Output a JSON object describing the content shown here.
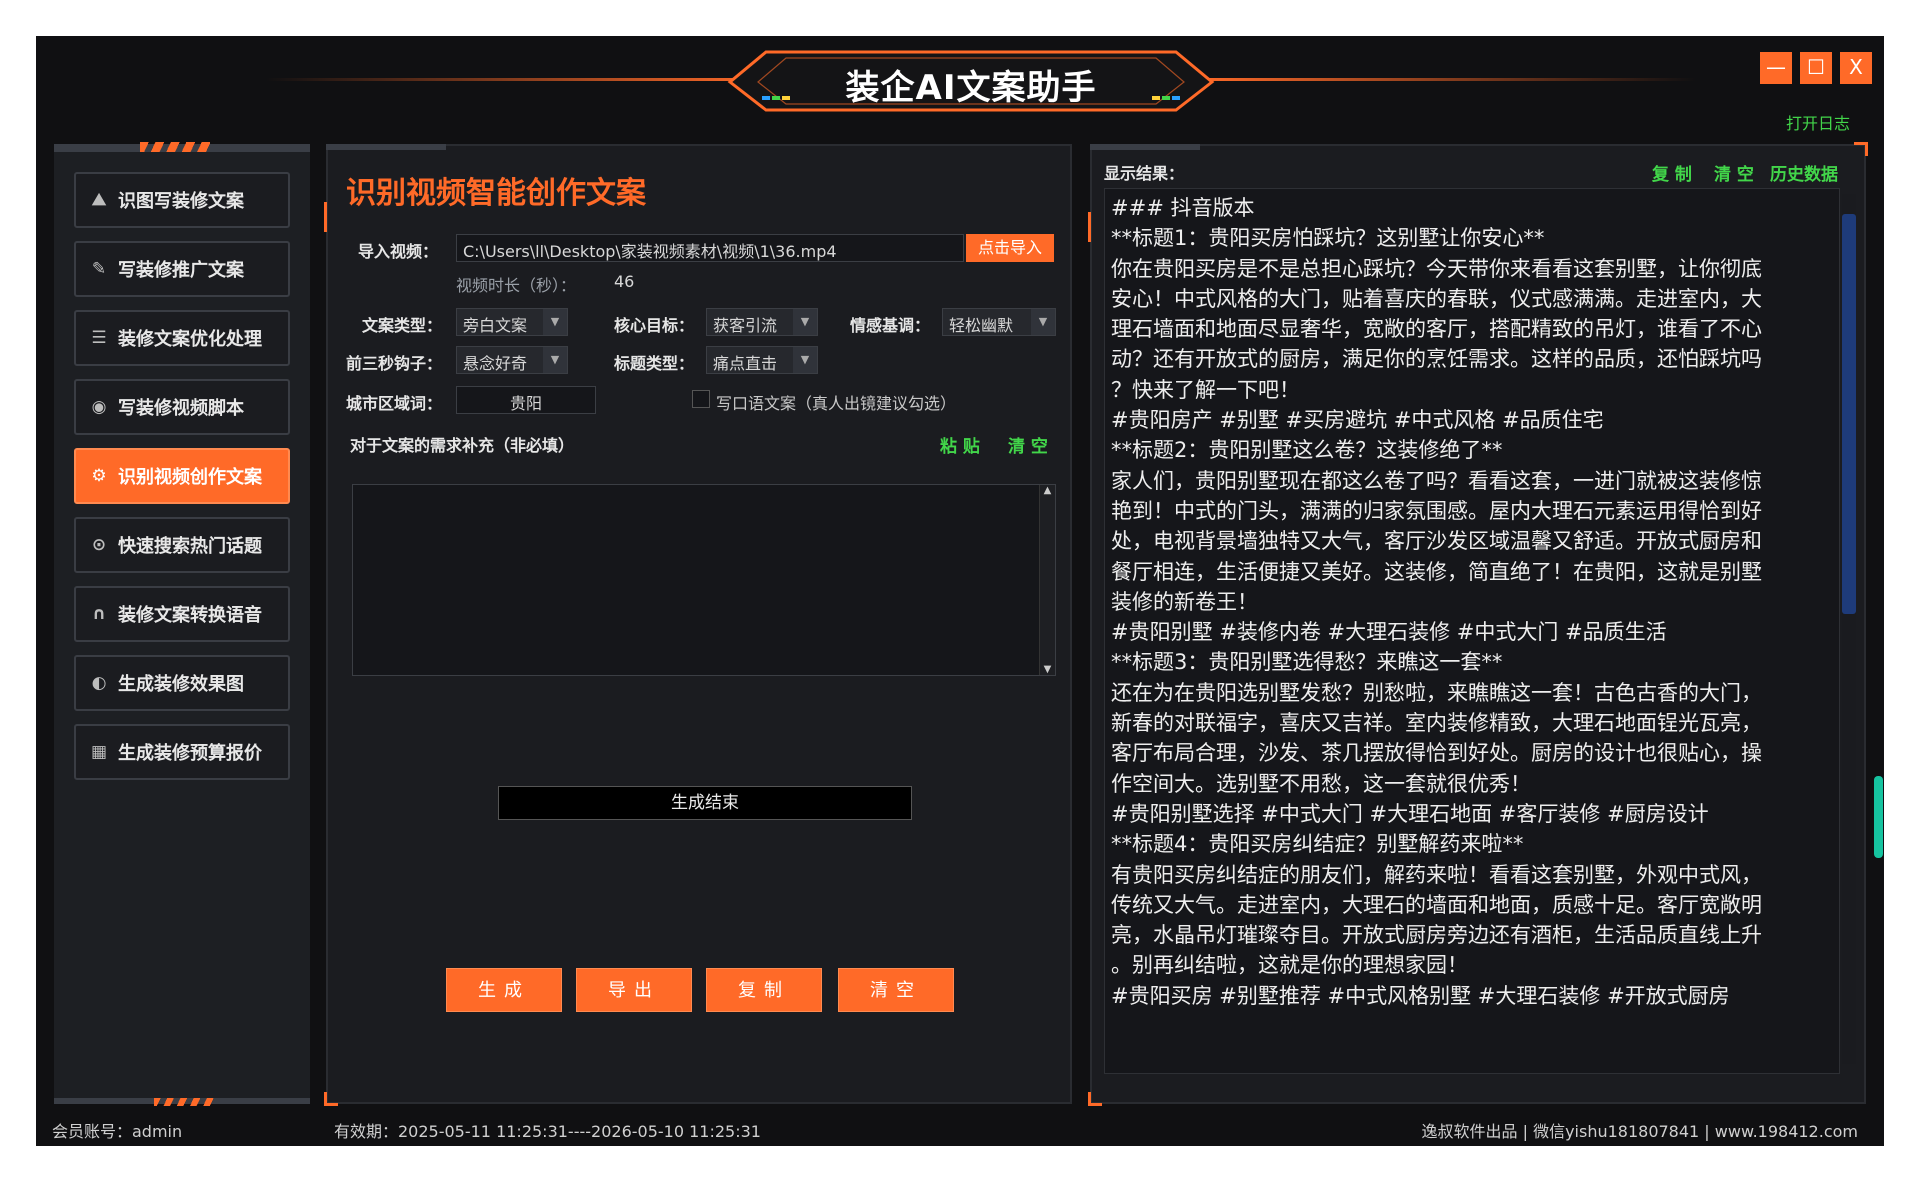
{
  "app": {
    "title": "装企AI文案助手",
    "open_log": "打开日志",
    "win_min": "—",
    "win_max": "☐",
    "win_close": "X"
  },
  "sidebar": {
    "items": [
      {
        "label": "识图写装修文案",
        "icon": "picture-icon",
        "glyph": "⛰"
      },
      {
        "label": "写装修推广文案",
        "icon": "pen-icon",
        "glyph": "✎"
      },
      {
        "label": "装修文案优化处理",
        "icon": "document-icon",
        "glyph": "☰"
      },
      {
        "label": "写装修视频脚本",
        "icon": "camera-icon",
        "glyph": "◉"
      },
      {
        "label": "识别视频创作文案",
        "icon": "video-icon",
        "glyph": "⚙"
      },
      {
        "label": "快速搜索热门话题",
        "icon": "location-icon",
        "glyph": "⊙"
      },
      {
        "label": "装修文案转换语音",
        "icon": "headphones-icon",
        "glyph": "∩"
      },
      {
        "label": "生成装修效果图",
        "icon": "palette-icon",
        "glyph": "◐"
      },
      {
        "label": "生成装修预算报价",
        "icon": "calculator-icon",
        "glyph": "▦"
      }
    ],
    "active_index": 4
  },
  "panel": {
    "title": "识别视频智能创作文案",
    "import_label": "导入视频：",
    "import_path": "C:\\Users\\ll\\Desktop\\家装视频素材\\视频\\1\\36.mp4",
    "import_button": "点击导入",
    "duration_label": "视频时长（秒）：",
    "duration_value": "46",
    "copy_type_label": "文案类型：",
    "copy_type_value": "旁白文案",
    "goal_label": "核心目标：",
    "goal_value": "获客引流",
    "tone_label": "情感基调：",
    "tone_value": "轻松幽默",
    "hook_label": "前三秒钩子：",
    "hook_value": "悬念好奇",
    "title_type_label": "标题类型：",
    "title_type_value": "痛点直击",
    "city_label": "城市区域词：",
    "city_value": "贵阳",
    "oral_checkbox": "写口语文案（真人出镜建议勾选）",
    "extra_label": "对于文案的需求补充（非必填）",
    "paste": "粘 贴",
    "clear": "清 空",
    "status": "生成结束",
    "btn_generate": "生成",
    "btn_export": "导出",
    "btn_copy": "复制",
    "btn_clear": "清空"
  },
  "result": {
    "label": "显示结果：",
    "copy": "复 制",
    "clear": "清 空",
    "history": "历史数据",
    "lines": [
      "### 抖音版本",
      "**标题1：贵阳买房怕踩坑？这别墅让你安心**",
      "你在贵阳买房是不是总担心踩坑？今天带你来看看这套别墅，让你彻底",
      "安心！中式风格的大门，贴着喜庆的春联，仪式感满满。走进室内，大",
      "理石墙面和地面尽显奢华，宽敞的客厅，搭配精致的吊灯，谁看了不心",
      "动？还有开放式的厨房，满足你的烹饪需求。这样的品质，还怕踩坑吗",
      "？快来了解一下吧！",
      "#贵阳房产 #别墅 #买房避坑 #中式风格 #品质住宅",
      "",
      "**标题2：贵阳别墅这么卷？这装修绝了**",
      "家人们，贵阳别墅现在都这么卷了吗？看看这套，一进门就被这装修惊",
      "艳到！中式的门头，满满的归家氛围感。屋内大理石元素运用得恰到好",
      "处，电视背景墙独特又大气，客厅沙发区域温馨又舒适。开放式厨房和",
      "餐厅相连，生活便捷又美好。这装修，简直绝了！在贵阳，这就是别墅",
      "装修的新卷王！",
      "#贵阳别墅 #装修内卷 #大理石装修 #中式大门 #品质生活",
      "",
      "**标题3：贵阳别墅选得愁？来瞧这一套**",
      "还在为在贵阳选别墅发愁？别愁啦，来瞧瞧这一套！古色古香的大门，",
      "新春的对联福字，喜庆又吉祥。室内装修精致，大理石地面锃光瓦亮，",
      "客厅布局合理，沙发、茶几摆放得恰到好处。厨房的设计也很贴心，操",
      "作空间大。选别墅不用愁，这一套就很优秀！",
      "#贵阳别墅选择 #中式大门 #大理石地面 #客厅装修 #厨房设计",
      "",
      "**标题4：贵阳买房纠结症？别墅解药来啦**",
      "有贵阳买房纠结症的朋友们，解药来啦！看看这套别墅，外观中式风，",
      "传统又大气。走进室内，大理石的墙面和地面，质感十足。客厅宽敞明",
      "亮，水晶吊灯璀璨夺目。开放式厨房旁边还有酒柜，生活品质直线上升",
      "。别再纠结啦，这就是你的理想家园！",
      "#贵阳买房 #别墅推荐 #中式风格别墅 #大理石装修 #开放式厨房"
    ]
  },
  "footer": {
    "member": "会员账号：admin",
    "validity": "有效期：2025-05-11 11:25:31----2026-05-10 11:25:31",
    "credit": "逸叔软件出品 | 微信yishu181807841 | www.198412.com"
  },
  "colors": {
    "accent": "#ff6a28",
    "green": "#42d64a",
    "bg": "#101012"
  }
}
